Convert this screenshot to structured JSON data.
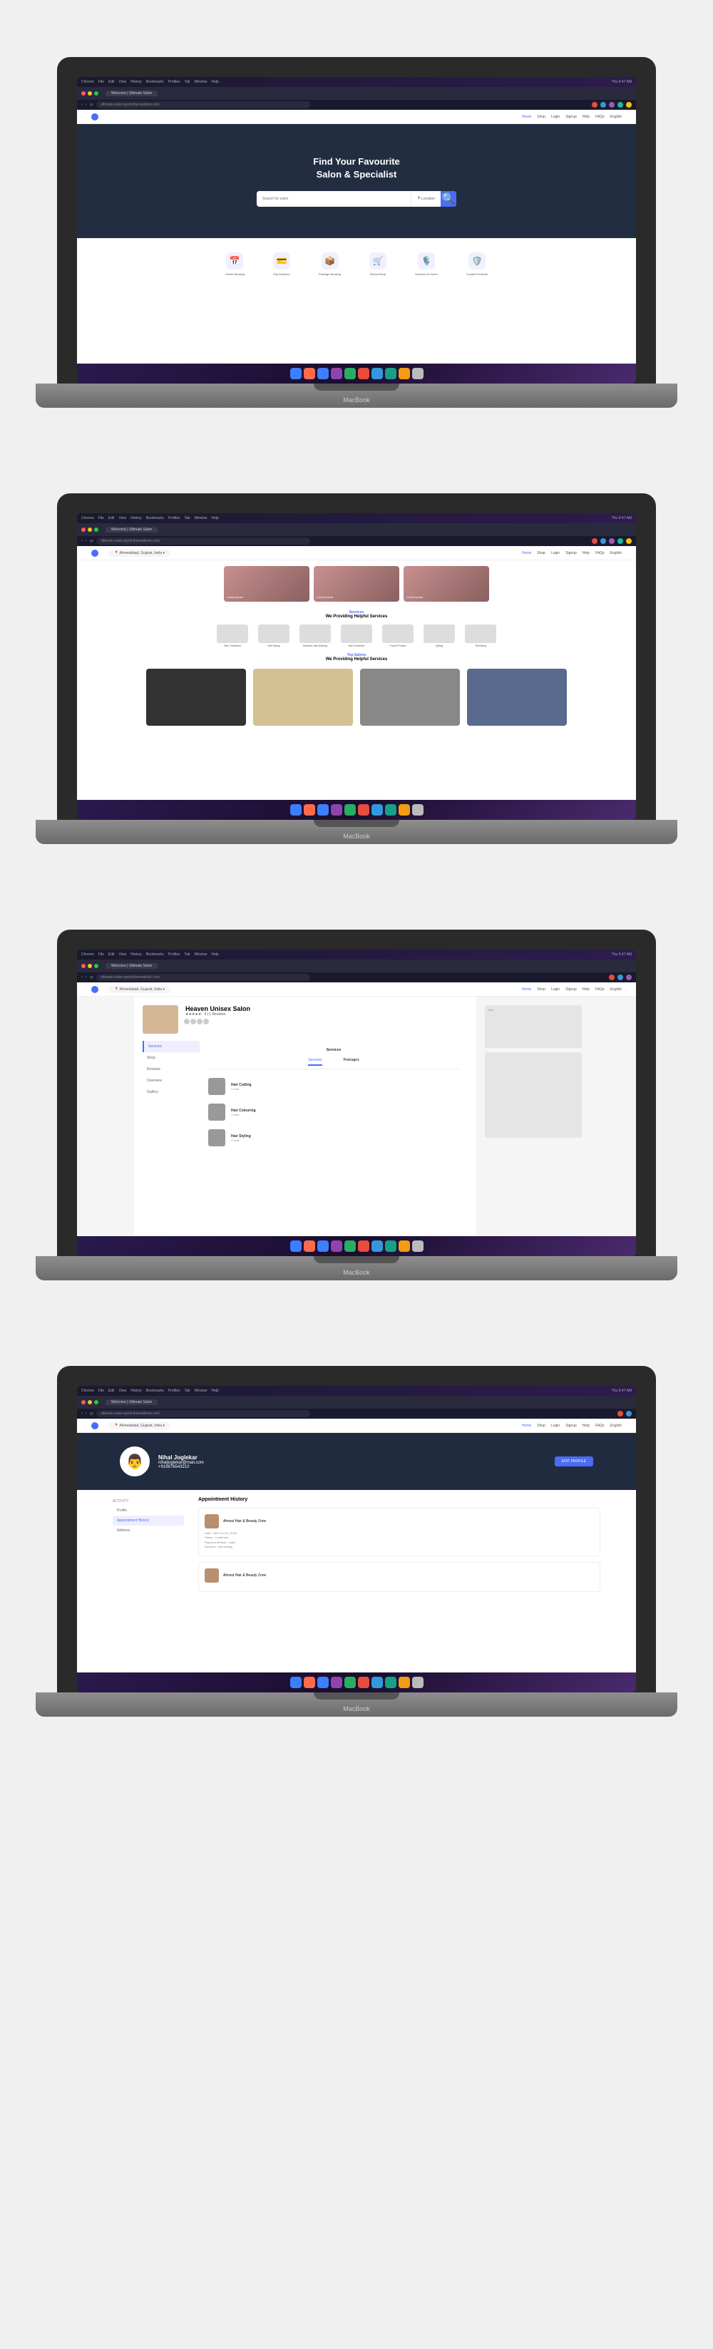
{
  "menubar": {
    "items": [
      "Chrome",
      "File",
      "Edit",
      "View",
      "History",
      "Bookmarks",
      "Profiles",
      "Tab",
      "Window",
      "Help"
    ],
    "datetime": "Thu 9:47 AM"
  },
  "browser": {
    "tab": "Welcome | Ultimate Salon",
    "url": "ultimate-salon.iqonicthemedemo.com"
  },
  "nav": {
    "location_label": "Ahmedabad, Gujarat, India",
    "links": [
      "Home",
      "Shop",
      "Login",
      "Signup",
      "Help",
      "FAQs",
      "English"
    ]
  },
  "screen1": {
    "hero_title1": "Find Your Favourite",
    "hero_title2": "Salon & Specialist",
    "search_placeholder": "Search for salon",
    "loc_label": "Location",
    "features": [
      "Online Booking",
      "Pay Modules",
      "Package Booking",
      "Rental Shop",
      "Services At Home",
      "Trusted Products"
    ]
  },
  "screen2": {
    "services_sub": "Services",
    "services_title": "We Providing Helpful Services",
    "services": [
      "Skin Treatment",
      "Nail Styling",
      "Machine Nail Working",
      "Nail Treatment",
      "Protein Protein",
      "Styling",
      "Threading"
    ],
    "salons_sub": "Top Salons",
    "salons_title": "We Providing Helpful Services"
  },
  "screen3": {
    "salon_name": "Heaven Unisex Salon",
    "reviews": "4 | 1 Reviews",
    "side_tabs": [
      "Services",
      "Shop",
      "Reviews",
      "Overview",
      "Gallery"
    ],
    "content_title": "Services",
    "sub_tabs": [
      "Services",
      "Packages"
    ],
    "items": [
      {
        "name": "Hair Cutting",
        "meta": "1 hour"
      },
      {
        "name": "Hair Colouring",
        "meta": "1 hour"
      },
      {
        "name": "Hair Styling",
        "meta": "1 hour"
      }
    ],
    "right_label": "Cart"
  },
  "screen4": {
    "user_name": "Nihal Joglekar",
    "user_email": "nihaljoglekar@mail.com",
    "user_phone": "+919876543210",
    "edit_btn": "EDIT PROFILE",
    "activity_label": "ACTIVITY",
    "side": [
      "Profile",
      "Appointment History",
      "Address"
    ],
    "main_title": "Appointment History",
    "appts": [
      {
        "name": "Almost Hair & Beauty Zone",
        "meta": "Date : 2022-11-09 | 10:00\nStatus : Confirmed\nPayment Method : Cash\nServices : Hair cutting"
      },
      {
        "name": "Almost Hair & Beauty Zone",
        "meta": ""
      }
    ]
  },
  "dock_colors": [
    "#3d7eff",
    "#ff6b4a",
    "#3d7eff",
    "#8e44ad",
    "#27ae60",
    "#e74c3c",
    "#3498db",
    "#16a085",
    "#f39c12",
    "#bbb"
  ],
  "macbook": "MacBook"
}
